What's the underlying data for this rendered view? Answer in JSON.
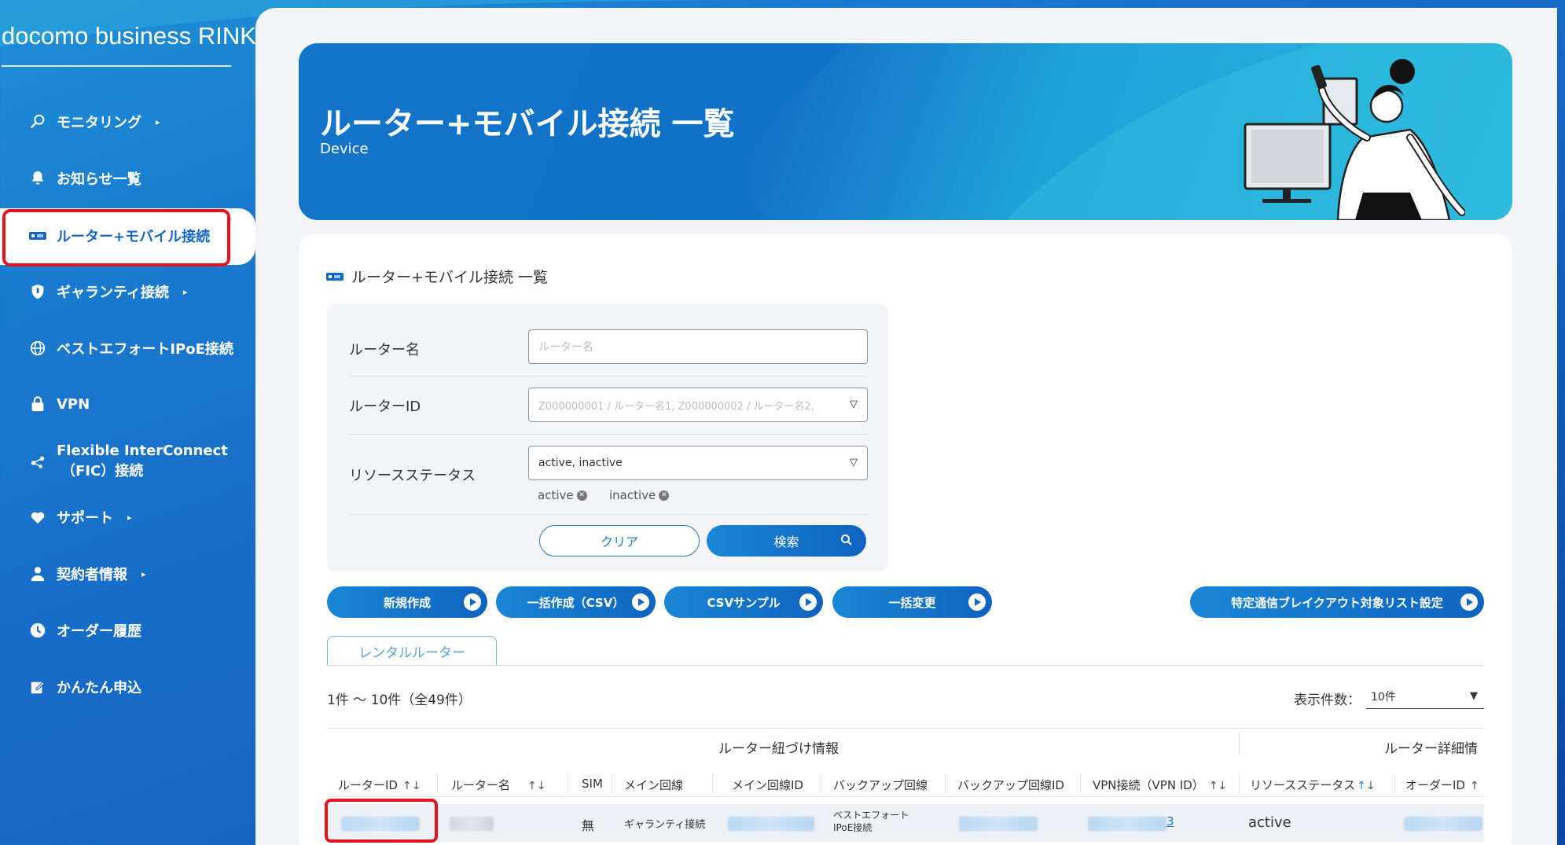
{
  "brand": "docomo business RINK",
  "sidebar": {
    "items": [
      {
        "label": "モニタリング",
        "arrow": "▸"
      },
      {
        "label": "お知らせ一覧",
        "arrow": ""
      },
      {
        "label": "ルーター+モバイル接続",
        "arrow": ""
      },
      {
        "label": "ギャランティ接続",
        "arrow": "▸"
      },
      {
        "label": "ベストエフォートIPoE接続",
        "arrow": ""
      },
      {
        "label": "VPN",
        "arrow": ""
      },
      {
        "label_line1": "Flexible InterConnect",
        "label_line2": "（FIC）接続",
        "arrow": ""
      },
      {
        "label": "サポート",
        "arrow": "▸"
      },
      {
        "label": "契約者情報",
        "arrow": "▸"
      },
      {
        "label": "オーダー履歴",
        "arrow": ""
      },
      {
        "label": "かんたん申込",
        "arrow": ""
      }
    ]
  },
  "hero": {
    "title": "ルーター+モバイル接続 一覧",
    "subtitle": "Device"
  },
  "section_title": "ルーター+モバイル接続 一覧",
  "filter": {
    "router_name_label": "ルーター名",
    "router_name_placeholder": "ルーター名",
    "router_id_label": "ルーターID",
    "router_id_placeholder": "Z000000001 / ルーター名1, Z000000002 / ルーター名2,",
    "status_label": "リソースステータス",
    "status_value": "active, inactive",
    "chips": [
      "active",
      "inactive"
    ],
    "clear_label": "クリア",
    "search_label": "検索"
  },
  "actions": [
    "新規作成",
    "一括作成（CSV）",
    "CSVサンプル",
    "一括変更",
    "特定通信ブレイクアウト対象リスト設定"
  ],
  "tab": "レンタルルーター",
  "count": "1件 ～ 10件（全49件）",
  "per_page_label": "表示件数：",
  "per_page_value": "10件",
  "table": {
    "group_headers": [
      "ルーター紐づけ情報",
      "ルーター詳細情"
    ],
    "columns": [
      "ルーターID",
      "ルーター名",
      "SIM",
      "メイン回線",
      "メイン回線ID",
      "バックアップ回線",
      "バックアップ回線ID",
      "VPN接続（VPN ID）",
      "リソースステータス",
      "オーダーID"
    ],
    "sort_glyphs": {
      "both": "↑↓",
      "up": "↑",
      "down": "↓"
    },
    "rows": [
      {
        "sim": "無",
        "main_line": "ギャランティ接続",
        "backup_line_1": "ベストエフォート",
        "backup_line_2": "IPoE接続",
        "vpn_suffix": "3",
        "status": "active"
      }
    ]
  },
  "colors": {
    "accent": "#1565c4",
    "highlight": "#e3141e",
    "panel": "#f2f4f7"
  }
}
